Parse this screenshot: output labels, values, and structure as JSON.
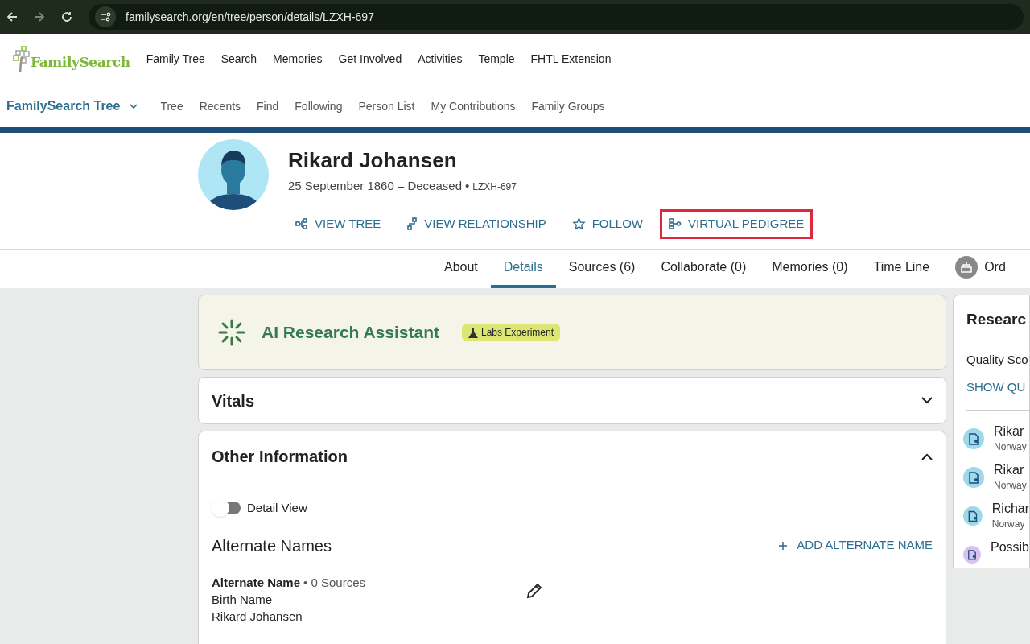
{
  "browser": {
    "url": "familysearch.org/en/tree/person/details/LZXH-697"
  },
  "header": {
    "logo": "FamilySearch",
    "nav": [
      "Family Tree",
      "Search",
      "Memories",
      "Get Involved",
      "Activities",
      "Temple",
      "FHTL Extension"
    ]
  },
  "subnav": {
    "title": "FamilySearch Tree",
    "items": [
      "Tree",
      "Recents",
      "Find",
      "Following",
      "Person List",
      "My Contributions",
      "Family Groups"
    ]
  },
  "person": {
    "name": "Rikard Johansen",
    "dates": "25 September 1860 – Deceased",
    "separator": "•",
    "id": "LZXH-697",
    "actions": [
      {
        "kind": "tree",
        "label": "VIEW TREE",
        "highlighted": false
      },
      {
        "kind": "relationship",
        "label": "VIEW RELATIONSHIP",
        "highlighted": false
      },
      {
        "kind": "follow",
        "label": "FOLLOW",
        "highlighted": false
      },
      {
        "kind": "pedigree",
        "label": "VIRTUAL PEDIGREE",
        "highlighted": true
      }
    ]
  },
  "tabs": [
    {
      "label": "About",
      "selected": false
    },
    {
      "label": "Details",
      "selected": true
    },
    {
      "label": "Sources (6)",
      "selected": false
    },
    {
      "label": "Collaborate (0)",
      "selected": false
    },
    {
      "label": "Memories (0)",
      "selected": false
    },
    {
      "label": "Time Line",
      "selected": false
    },
    {
      "label": "Ord",
      "selected": false,
      "kind": "ordinances"
    }
  ],
  "ai_banner": {
    "title": "AI Research Assistant",
    "badge": "Labs Experiment"
  },
  "vitals": {
    "title": "Vitals",
    "expanded": false
  },
  "other_information": {
    "title": "Other Information",
    "expanded": true,
    "detail_view": {
      "label": "Detail View",
      "on": false
    },
    "alternate_names": {
      "title": "Alternate Names",
      "add": "ADD ALTERNATE NAME",
      "entries": [
        {
          "label": "Alternate Name",
          "sources": "• 0 Sources",
          "type": "Birth Name",
          "name": "Rikard Johansen"
        }
      ]
    }
  },
  "research_panel": {
    "title": "Researc",
    "quality": "Quality Sco",
    "show": "SHOW QU",
    "items": [
      {
        "kind": "record",
        "title": "Rikar",
        "place": "Norway"
      },
      {
        "kind": "record",
        "title": "Rikar",
        "place": "Norway"
      },
      {
        "kind": "record",
        "title": "Richar",
        "place": "Norway"
      },
      {
        "kind": "hint",
        "title": "Possib"
      }
    ]
  }
}
